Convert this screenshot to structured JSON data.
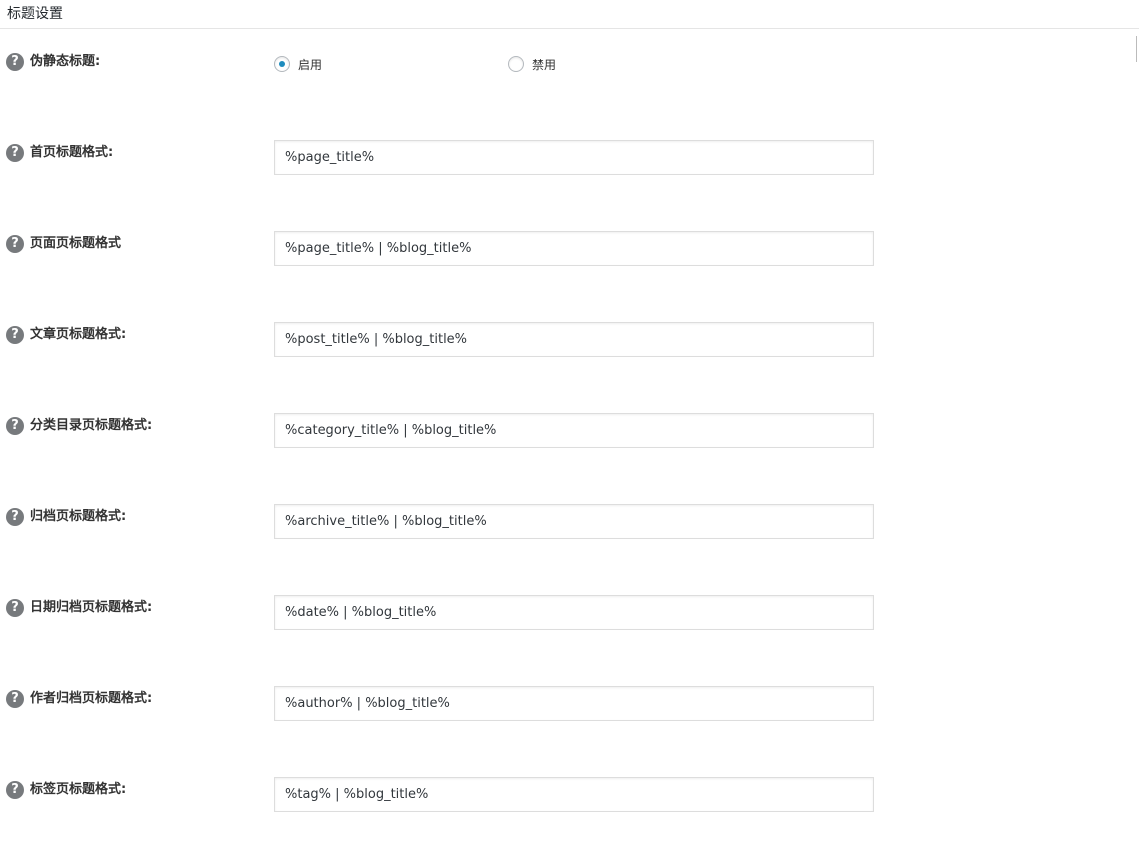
{
  "section": {
    "title": "标题设置"
  },
  "fields": {
    "pseudo_static": {
      "label": "伪静态标题:",
      "options": [
        "启用",
        "禁用"
      ],
      "selected": "启用"
    },
    "home": {
      "label": "首页标题格式:",
      "value": "%page_title%"
    },
    "page": {
      "label": "页面页标题格式",
      "value": "%page_title% | %blog_title%"
    },
    "post": {
      "label": "文章页标题格式:",
      "value": "%post_title% | %blog_title%"
    },
    "category": {
      "label": "分类目录页标题格式:",
      "value": "%category_title% | %blog_title%"
    },
    "archive": {
      "label": "归档页标题格式:",
      "value": "%archive_title% | %blog_title%"
    },
    "date": {
      "label": "日期归档页标题格式:",
      "value": "%date% | %blog_title%"
    },
    "author": {
      "label": "作者归档页标题格式:",
      "value": "%author% | %blog_title%"
    },
    "tag": {
      "label": "标签页标题格式:",
      "value": "%tag% | %blog_title%"
    }
  },
  "help_icon_glyph": "?",
  "colors": {
    "accent": "#1e8cbe",
    "help_icon_bg": "#777a7d",
    "input_border": "#dddddd"
  }
}
